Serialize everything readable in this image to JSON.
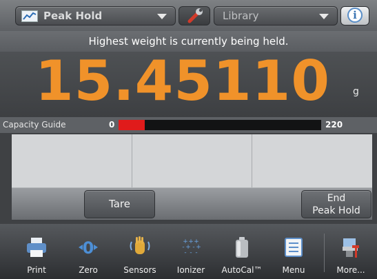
{
  "app_selector": {
    "label": "Peak Hold",
    "icon": "line-chart-icon"
  },
  "settings_button": {
    "icon": "wrench-icon"
  },
  "library_selector": {
    "label": "Library"
  },
  "info_button": {
    "icon": "info-icon",
    "glyph": "i"
  },
  "message": "Highest weight is currently being held.",
  "weight": {
    "value": "15.45110",
    "unit": "g",
    "color": "#f0922a"
  },
  "capacity_guide": {
    "label": "Capacity Guide",
    "min": "0",
    "max": "220",
    "fill_fraction": 0.13,
    "fill_color": "#e01b1b"
  },
  "actions": {
    "tare": "Tare",
    "end_line1": "End",
    "end_line2": "Peak Hold"
  },
  "nav": [
    {
      "label": "Print",
      "icon": "printer-icon"
    },
    {
      "label": "Zero",
      "icon": "zero-icon"
    },
    {
      "label": "Sensors",
      "icon": "hand-sensor-icon"
    },
    {
      "label": "Ionizer",
      "icon": "ionizer-icon"
    },
    {
      "label": "AutoCal™",
      "icon": "autocal-weight-icon"
    },
    {
      "label": "Menu",
      "icon": "menu-icon"
    },
    {
      "label": "More...",
      "icon": "more-icon"
    }
  ]
}
